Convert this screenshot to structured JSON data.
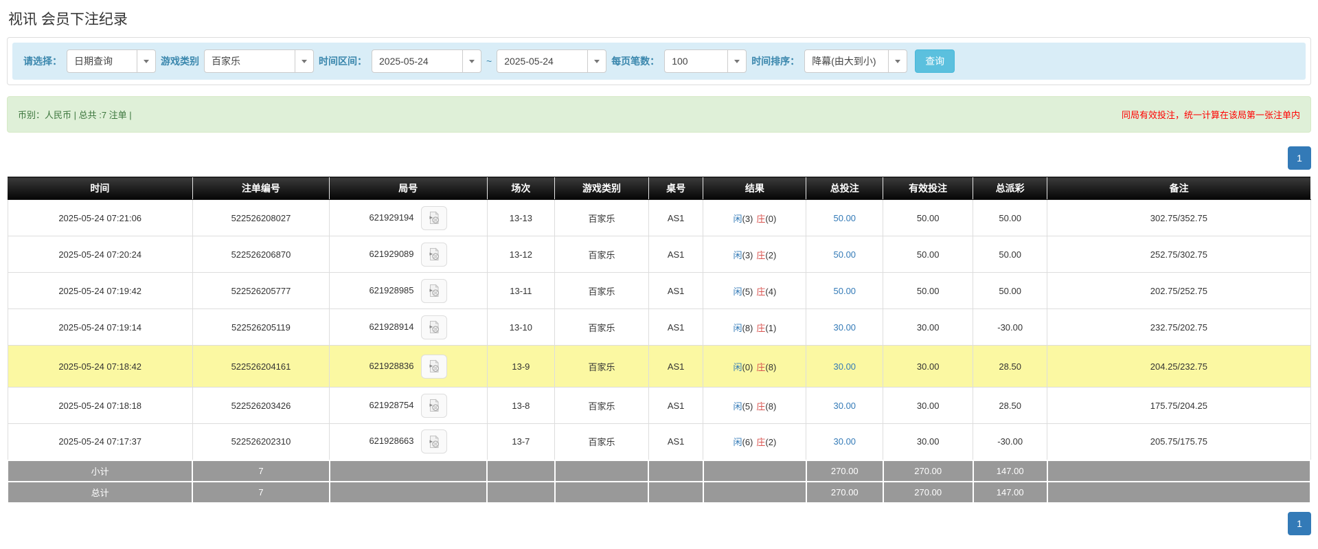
{
  "page": {
    "title": "视讯 会员下注纪录"
  },
  "filters": {
    "select_label": "请选择：",
    "select_value": "日期查询",
    "game_type_label": "游戏类别",
    "game_type_value": "百家乐",
    "time_range_label": "时间区间：",
    "date_from": "2025-05-24",
    "tilde": "~",
    "date_to": "2025-05-24",
    "page_size_label": "每页笔数：",
    "page_size_value": "100",
    "sort_label": "时间排序：",
    "sort_value": "降幕(由大到小)",
    "search_button": "查询"
  },
  "summary": {
    "left_text": "币别：人民币 | 总共 :7 注单 |",
    "right_note": "同局有效投注，统一计算在该局第一张注单内"
  },
  "pagination": {
    "page": "1"
  },
  "icons": {
    "select_caret": "chevron-down",
    "round_video": "video-film-reel"
  },
  "colors": {
    "filter_bar_bg": "#d9edf7",
    "filter_label": "#3a87ad",
    "search_button_bg": "#5bc0de",
    "summary_bg": "#dff0d8",
    "summary_text": "#3c763d",
    "note_red": "#ff0000",
    "header_bg": "#000000",
    "highlight_row": "#fbf8a2",
    "footer_row_bg": "#999999",
    "pagination_bg": "#337ab7",
    "player_blue": "#337ab7",
    "banker_red": "#d9534f",
    "link_blue": "#337ab7"
  },
  "table": {
    "columns": [
      "时间",
      "注单编号",
      "局号",
      "场次",
      "游戏类别",
      "桌号",
      "结果",
      "总投注",
      "有效投注",
      "总派彩",
      "备注"
    ],
    "rows": [
      {
        "time": "2025-05-24 07:21:06",
        "bet_id": "522526208027",
        "round_id": "621929194",
        "session": "13-13",
        "game": "百家乐",
        "table_no": "AS1",
        "result_player": "闲",
        "result_player_num": "(3)",
        "result_banker": "庄",
        "result_banker_num": "(0)",
        "total_bet": "50.00",
        "valid_bet": "50.00",
        "payout": "50.00",
        "remark": "302.75/352.75",
        "highlight": false
      },
      {
        "time": "2025-05-24 07:20:24",
        "bet_id": "522526206870",
        "round_id": "621929089",
        "session": "13-12",
        "game": "百家乐",
        "table_no": "AS1",
        "result_player": "闲",
        "result_player_num": "(3)",
        "result_banker": "庄",
        "result_banker_num": "(2)",
        "total_bet": "50.00",
        "valid_bet": "50.00",
        "payout": "50.00",
        "remark": "252.75/302.75",
        "highlight": false
      },
      {
        "time": "2025-05-24 07:19:42",
        "bet_id": "522526205777",
        "round_id": "621928985",
        "session": "13-11",
        "game": "百家乐",
        "table_no": "AS1",
        "result_player": "闲",
        "result_player_num": "(5)",
        "result_banker": "庄",
        "result_banker_num": "(4)",
        "total_bet": "50.00",
        "valid_bet": "50.00",
        "payout": "50.00",
        "remark": "202.75/252.75",
        "highlight": false
      },
      {
        "time": "2025-05-24 07:19:14",
        "bet_id": "522526205119",
        "round_id": "621928914",
        "session": "13-10",
        "game": "百家乐",
        "table_no": "AS1",
        "result_player": "闲",
        "result_player_num": "(8)",
        "result_banker": "庄",
        "result_banker_num": "(1)",
        "total_bet": "30.00",
        "valid_bet": "30.00",
        "payout": "-30.00",
        "remark": "232.75/202.75",
        "highlight": false
      },
      {
        "time": "2025-05-24 07:18:42",
        "bet_id": "522526204161",
        "round_id": "621928836",
        "session": "13-9",
        "game": "百家乐",
        "table_no": "AS1",
        "result_player": "闲",
        "result_player_num": "(0)",
        "result_banker": "庄",
        "result_banker_num": "(8)",
        "total_bet": "30.00",
        "valid_bet": "30.00",
        "payout": "28.50",
        "remark": "204.25/232.75",
        "highlight": true
      },
      {
        "time": "2025-05-24 07:18:18",
        "bet_id": "522526203426",
        "round_id": "621928754",
        "session": "13-8",
        "game": "百家乐",
        "table_no": "AS1",
        "result_player": "闲",
        "result_player_num": "(5)",
        "result_banker": "庄",
        "result_banker_num": "(8)",
        "total_bet": "30.00",
        "valid_bet": "30.00",
        "payout": "28.50",
        "remark": "175.75/204.25",
        "highlight": false
      },
      {
        "time": "2025-05-24 07:17:37",
        "bet_id": "522526202310",
        "round_id": "621928663",
        "session": "13-7",
        "game": "百家乐",
        "table_no": "AS1",
        "result_player": "闲",
        "result_player_num": "(6)",
        "result_banker": "庄",
        "result_banker_num": "(2)",
        "total_bet": "30.00",
        "valid_bet": "30.00",
        "payout": "-30.00",
        "remark": "205.75/175.75",
        "highlight": false
      }
    ],
    "subtotal": {
      "label": "小计",
      "count": "7",
      "total_bet": "270.00",
      "valid_bet": "270.00",
      "payout": "147.00"
    },
    "total": {
      "label": "总计",
      "count": "7",
      "total_bet": "270.00",
      "valid_bet": "270.00",
      "payout": "147.00"
    }
  }
}
